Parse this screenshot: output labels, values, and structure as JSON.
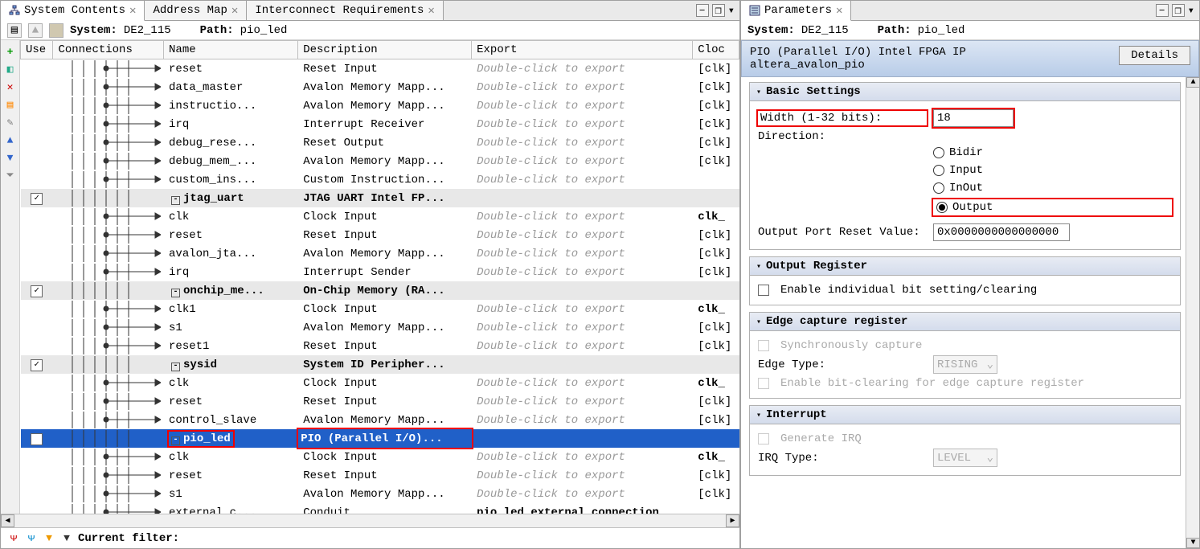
{
  "tabs": {
    "left": [
      {
        "label": "System Contents",
        "active": true,
        "icon": "hierarchy-icon"
      },
      {
        "label": "Address Map",
        "active": false,
        "icon": null
      },
      {
        "label": "Interconnect Requirements",
        "active": false,
        "icon": null
      }
    ],
    "right": [
      {
        "label": "Parameters",
        "active": true,
        "icon": "params-icon"
      }
    ]
  },
  "left_path": {
    "system_label": "System:",
    "system_value": "DE2_115",
    "path_label": "Path:",
    "path_value": "pio_led"
  },
  "columns": {
    "use": "Use",
    "conn": "Connections",
    "name": "Name",
    "desc": "Description",
    "export": "Export",
    "clock": "Cloc"
  },
  "export_hint": "Double-click to export",
  "rows": [
    {
      "kind": "sub",
      "name": "reset",
      "desc": "Reset Input",
      "clock": "[clk]",
      "export_hint": true
    },
    {
      "kind": "sub",
      "name": "data_master",
      "desc": "Avalon Memory Mapp...",
      "clock": "[clk]",
      "export_hint": true
    },
    {
      "kind": "sub",
      "name": "instructio...",
      "desc": "Avalon Memory Mapp...",
      "clock": "[clk]",
      "export_hint": true
    },
    {
      "kind": "sub",
      "name": "irq",
      "desc": "Interrupt Receiver",
      "clock": "[clk]",
      "export_hint": true
    },
    {
      "kind": "sub",
      "name": "debug_rese...",
      "desc": "Reset Output",
      "clock": "[clk]",
      "export_hint": true
    },
    {
      "kind": "sub",
      "name": "debug_mem_...",
      "desc": "Avalon Memory Mapp...",
      "clock": "[clk]",
      "export_hint": true
    },
    {
      "kind": "sub",
      "name": "custom_ins...",
      "desc": "Custom Instruction...",
      "clock": "",
      "export_hint": true
    },
    {
      "kind": "parent",
      "checked": true,
      "name": "jtag_uart",
      "desc": "JTAG UART Intel FP...",
      "clock": "",
      "export_hint": false
    },
    {
      "kind": "sub",
      "name": "clk",
      "desc": "Clock Input",
      "clock": "clk_",
      "clock_bold": true,
      "export_hint": true
    },
    {
      "kind": "sub",
      "name": "reset",
      "desc": "Reset Input",
      "clock": "[clk]",
      "export_hint": true
    },
    {
      "kind": "sub",
      "name": "avalon_jta...",
      "desc": "Avalon Memory Mapp...",
      "clock": "[clk]",
      "export_hint": true
    },
    {
      "kind": "sub",
      "name": "irq",
      "desc": "Interrupt Sender",
      "clock": "[clk]",
      "export_hint": true
    },
    {
      "kind": "parent",
      "checked": true,
      "name": "onchip_me...",
      "desc": "On-Chip Memory (RA...",
      "clock": "",
      "export_hint": false
    },
    {
      "kind": "sub",
      "name": "clk1",
      "desc": "Clock Input",
      "clock": "clk_",
      "clock_bold": true,
      "export_hint": true
    },
    {
      "kind": "sub",
      "name": "s1",
      "desc": "Avalon Memory Mapp...",
      "clock": "[clk]",
      "export_hint": true
    },
    {
      "kind": "sub",
      "name": "reset1",
      "desc": "Reset Input",
      "clock": "[clk]",
      "export_hint": true
    },
    {
      "kind": "parent",
      "checked": true,
      "name": "sysid",
      "desc": "System ID Peripher...",
      "clock": "",
      "export_hint": false
    },
    {
      "kind": "sub",
      "name": "clk",
      "desc": "Clock Input",
      "clock": "clk_",
      "clock_bold": true,
      "export_hint": true
    },
    {
      "kind": "sub",
      "name": "reset",
      "desc": "Reset Input",
      "clock": "[clk]",
      "export_hint": true
    },
    {
      "kind": "sub",
      "name": "control_slave",
      "desc": "Avalon Memory Mapp...",
      "clock": "[clk]",
      "export_hint": true
    },
    {
      "kind": "selected",
      "checked": true,
      "name": "pio_led",
      "desc": "PIO (Parallel I/O)...",
      "clock": "",
      "export_hint": false
    },
    {
      "kind": "sub",
      "name": "clk",
      "desc": "Clock Input",
      "clock": "clk_",
      "clock_bold": true,
      "export_hint": true
    },
    {
      "kind": "sub",
      "name": "reset",
      "desc": "Reset Input",
      "clock": "[clk]",
      "export_hint": true
    },
    {
      "kind": "sub",
      "name": "s1",
      "desc": "Avalon Memory Mapp...",
      "clock": "[clk]",
      "export_hint": true
    },
    {
      "kind": "sub",
      "name": "external_c...",
      "desc": "Conduit",
      "clock": "",
      "export": "pio_led_external_connection"
    }
  ],
  "filter_label": "Current filter:",
  "right_path": {
    "system_label": "System:",
    "system_value": "DE2_115",
    "path_label": "Path:",
    "path_value": "pio_led"
  },
  "ip_header": {
    "line1": "PIO (Parallel I/O) Intel FPGA IP",
    "line2": "altera_avalon_pio",
    "details": "Details"
  },
  "groups": {
    "basic": {
      "title": "Basic Settings",
      "width_label": "Width (1-32 bits):",
      "width_value": "18",
      "direction_label": "Direction:",
      "directions": [
        "Bidir",
        "Input",
        "InOut",
        "Output"
      ],
      "direction_selected": "Output",
      "reset_label": "Output Port Reset Value:",
      "reset_value": "0x0000000000000000"
    },
    "output_reg": {
      "title": "Output Register",
      "enable_label": "Enable individual bit setting/clearing"
    },
    "edge": {
      "title": "Edge capture register",
      "sync_label": "Synchronously capture",
      "edge_type_label": "Edge Type:",
      "edge_type_value": "RISING",
      "bitclear_label": "Enable bit-clearing for edge capture register"
    },
    "interrupt": {
      "title": "Interrupt",
      "gen_label": "Generate IRQ",
      "irq_type_label": "IRQ Type:",
      "irq_type_value": "LEVEL"
    }
  }
}
